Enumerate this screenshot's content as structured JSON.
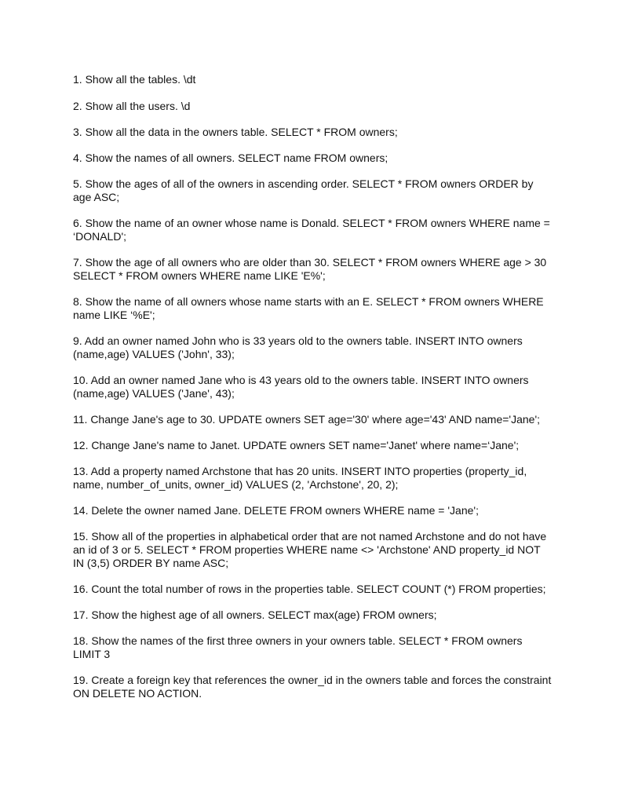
{
  "document": {
    "items": [
      "1.   Show all the tables. \\dt",
      "2. Show all the users. \\d",
      "3. Show all the data in the owners table. SELECT * FROM owners;",
      "4. Show the names of all owners. SELECT name FROM owners;",
      "5. Show the ages of all of the owners in ascending order. SELECT * FROM owners ORDER by age ASC;",
      "6. Show the name of an owner whose name is Donald. SELECT * FROM owners WHERE name = ‘DONALD';",
      "7. Show the age of all owners who are older than 30. SELECT * FROM owners WHERE age > 30 SELECT * FROM owners WHERE name LIKE 'E%';",
      "8. Show the name of all owners whose name starts with an E. SELECT * FROM owners WHERE name LIKE ‘%E';",
      "9. Add an owner named John who is 33 years old to the owners table. INSERT INTO owners (name,age) VALUES ('John', 33);",
      "10. Add an owner named Jane who is 43 years old to the owners table. INSERT INTO owners (name,age) VALUES ('Jane', 43);",
      "11. Change Jane's age to 30. UPDATE owners SET age='30' where age='43' AND name='Jane';",
      "12. Change Jane's name to Janet. UPDATE owners SET name='Janet' where name=‘Jane';",
      "13. Add a property named Archstone that has 20 units. INSERT INTO properties (property_id, name, number_of_units, owner_id) VALUES (2, 'Archstone', 20, 2);",
      "14. Delete the owner named Jane. DELETE FROM owners WHERE name = 'Jane';",
      "15. Show all of the properties in alphabetical order that are not named Archstone and do not have an id of 3 or 5.  SELECT * FROM properties WHERE name <> 'Archstone' AND property_id NOT IN (3,5) ORDER BY name ASC;",
      "16. Count the total number of rows in the properties table. SELECT COUNT (*) FROM properties;",
      "17. Show the highest age of all owners. SELECT max(age) FROM owners;",
      "18. Show the names of the first three owners in your owners table. SELECT * FROM owners LIMIT 3",
      "19. Create a foreign key that references the owner_id in the owners table and forces the constraint ON DELETE NO ACTION."
    ]
  }
}
